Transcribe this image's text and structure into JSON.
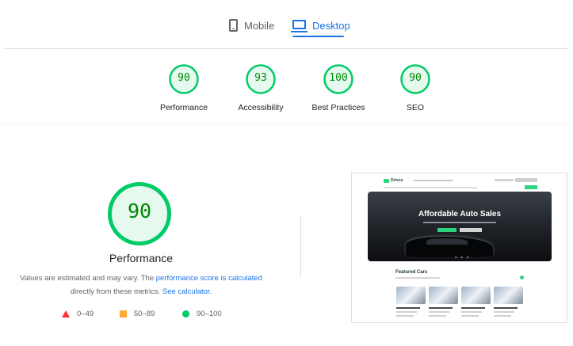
{
  "tabs": {
    "mobile_label": "Mobile",
    "desktop_label": "Desktop",
    "active": "Desktop"
  },
  "summary": {
    "gauges": [
      {
        "score": "90",
        "label": "Performance"
      },
      {
        "score": "93",
        "label": "Accessibility"
      },
      {
        "score": "100",
        "label": "Best Practices"
      },
      {
        "score": "90",
        "label": "SEO"
      }
    ]
  },
  "performance": {
    "score": "90",
    "title": "Performance",
    "desc_prefix": "Values are estimated and may vary. The ",
    "desc_link1": "performance score is calculated",
    "desc_middle": " directly from these metrics. ",
    "desc_link2": "See calculator."
  },
  "legend": [
    {
      "range": "0–49",
      "color": "#ff3333"
    },
    {
      "range": "50–89",
      "color": "#ffaa33"
    },
    {
      "range": "90–100",
      "color": "#00cc66"
    }
  ],
  "thumbnail": {
    "logo": "Drivco",
    "hero_title": "Affordable Auto Sales",
    "featured_title": "Featured Cars"
  },
  "colors": {
    "pass_green": "#00cc66",
    "pass_text": "#008800",
    "pass_fill": "#e6f9ee",
    "accent_blue": "#1a73e8"
  }
}
